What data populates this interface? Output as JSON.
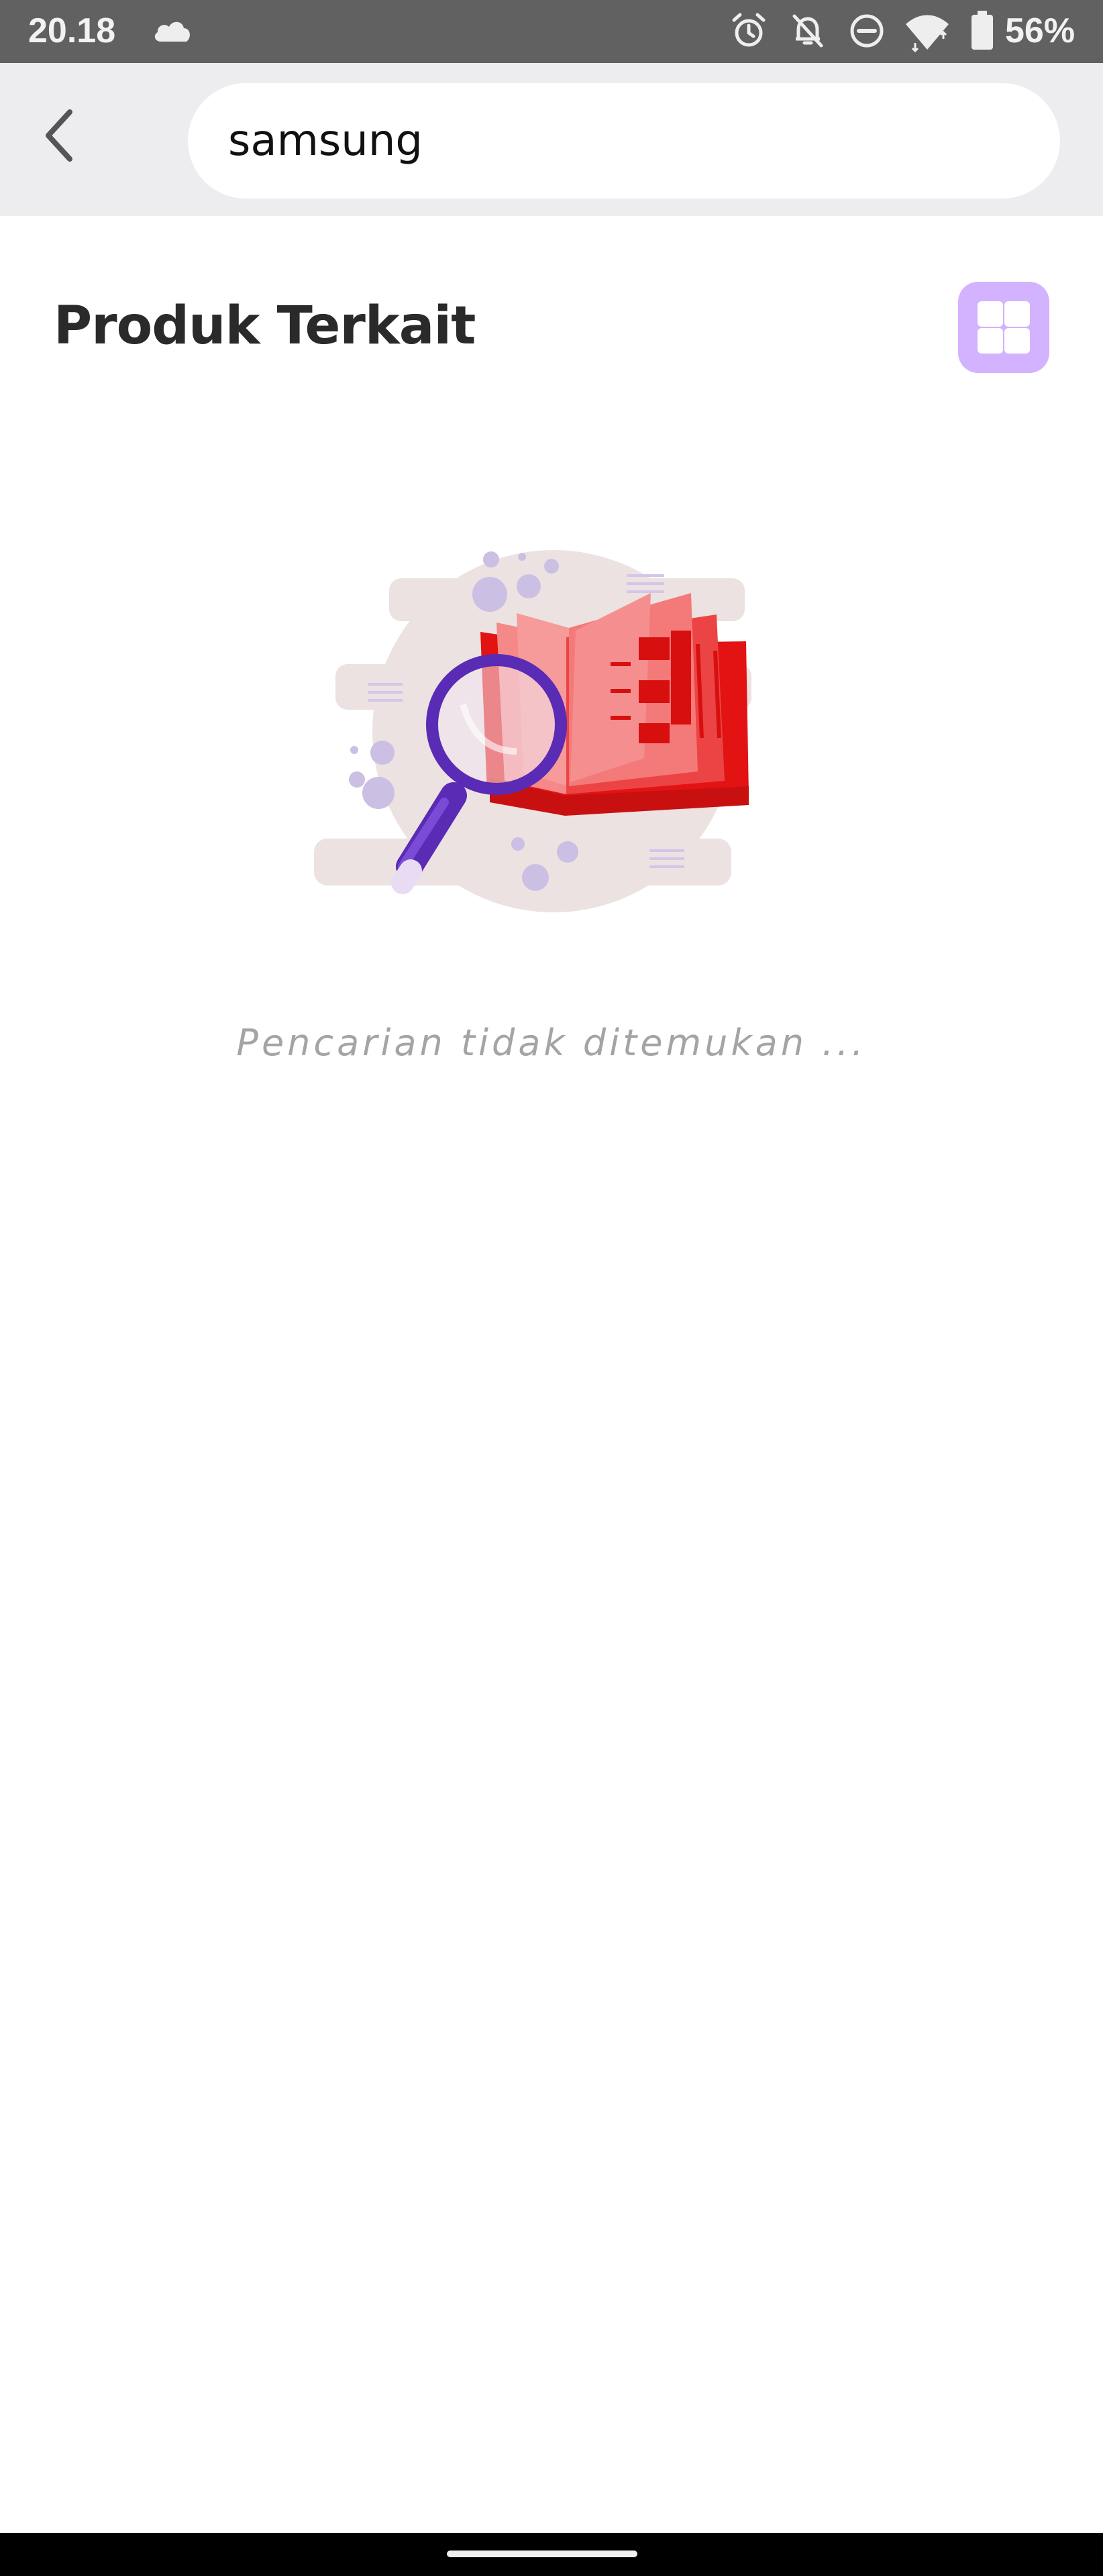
{
  "status_bar": {
    "time": "20.18",
    "battery": "56%",
    "icons": [
      "cloud-icon",
      "alarm-icon",
      "notifications-off-icon",
      "do-not-disturb-icon",
      "wifi-icon",
      "battery-icon"
    ]
  },
  "app_bar": {
    "back_icon": "chevron-left-icon",
    "search_value": "samsung"
  },
  "section": {
    "title": "Produk Terkait",
    "view_toggle_icon": "grid-icon"
  },
  "empty_state": {
    "illustration": "magnifier-over-book",
    "message": "Pencarian tidak ditemukan ..."
  },
  "colors": {
    "status_bar": "#616161",
    "app_bar": "#ededef",
    "accent": "#d3b2ff",
    "magnifier": "#5a2bb4",
    "book": "#ee1c1c",
    "message": "#a4a4a4"
  }
}
